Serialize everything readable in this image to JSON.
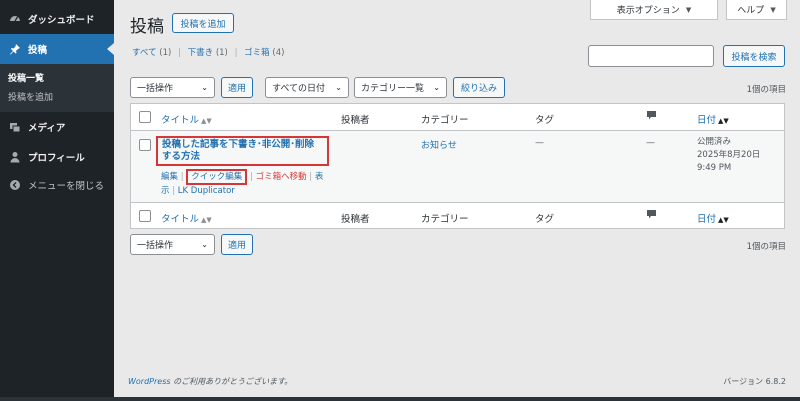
{
  "sidebar": {
    "dashboard": "ダッシュボード",
    "posts": "投稿",
    "submenu": [
      "投稿一覧",
      "投稿を追加"
    ],
    "media": "メディア",
    "profile": "プロフィール",
    "collapse": "メニューを閉じる"
  },
  "header": {
    "screen_options": "表示オプション",
    "help": "ヘルプ",
    "title": "投稿",
    "add_new": "投稿を追加"
  },
  "views": {
    "all": "すべて",
    "all_count": "(1)",
    "draft": "下書き",
    "draft_count": "(1)",
    "trash": "ゴミ箱",
    "trash_count": "(4)"
  },
  "search": {
    "button": "投稿を検索",
    "value": ""
  },
  "filters": {
    "bulk_action": "一括操作",
    "apply": "適用",
    "date": "すべての日付",
    "category": "カテゴリー一覧",
    "filter": "絞り込み",
    "items_count": "1個の項目"
  },
  "table": {
    "columns": {
      "title": "タイトル",
      "author": "投稿者",
      "category": "カテゴリー",
      "tags": "タグ",
      "date": "日付"
    },
    "row": {
      "title": "投稿した記事を下書き･非公開･削除する方法",
      "actions": {
        "edit": "編集",
        "quick_edit": "クイック編集",
        "trash": "ゴミ箱へ移動",
        "view": "表示",
        "duplicator": "LK Duplicator"
      },
      "author": "",
      "category": "お知らせ",
      "tags": "—",
      "comments": "—",
      "status": "公開済み",
      "date": "2025年8月20日",
      "time": "9:49 PM"
    }
  },
  "bottom_filters": {
    "bulk_action": "一括操作",
    "apply": "適用",
    "items_count": "1個の項目"
  },
  "footer": {
    "wordpress": "WordPress",
    "thanks": " のご利用ありがとうございます。",
    "version": "バージョン 6.8.2"
  }
}
